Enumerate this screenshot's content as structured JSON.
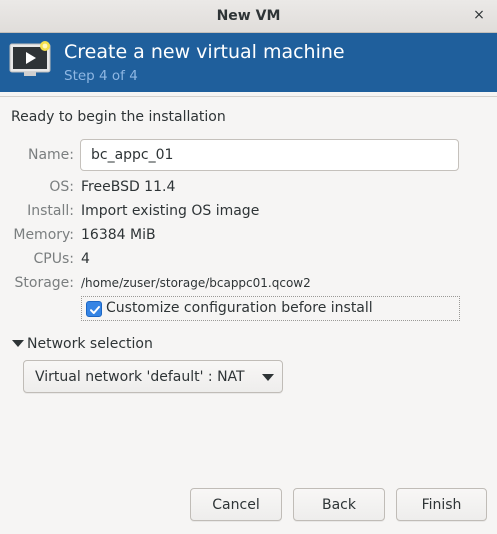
{
  "window": {
    "title": "New VM",
    "close_glyph": "×"
  },
  "banner": {
    "icon": "monitor-play-icon",
    "heading": "Create a new virtual machine",
    "step": "Step 4 of 4",
    "background": "#1f5f9c"
  },
  "summary": {
    "ready_text": "Ready to begin the installation",
    "name_label": "Name:",
    "name_value": "bc_appc_01",
    "os_label": "OS:",
    "os_value": "FreeBSD 11.4",
    "install_label": "Install:",
    "install_value": "Import existing OS image",
    "memory_label": "Memory:",
    "memory_value": "16384 MiB",
    "cpus_label": "CPUs:",
    "cpus_value": "4",
    "storage_label": "Storage:",
    "storage_value": "/home/zuser/storage/bcappc01.qcow2"
  },
  "customize": {
    "label": "Customize configuration before install",
    "checked": true
  },
  "network": {
    "expander_label": "Network selection",
    "selected": "Virtual network 'default' : NAT"
  },
  "buttons": {
    "cancel": "Cancel",
    "back": "Back",
    "finish": "Finish"
  },
  "colors": {
    "accent": "#3584e4",
    "label_gray": "#7a7e7f"
  }
}
